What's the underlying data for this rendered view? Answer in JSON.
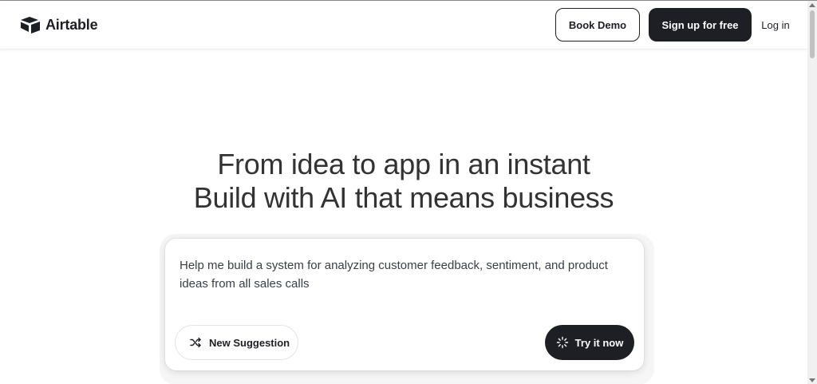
{
  "header": {
    "logo_text": "Airtable",
    "book_demo_label": "Book Demo",
    "signup_label": "Sign up for free",
    "login_label": "Log in"
  },
  "hero": {
    "line1": "From idea to app in an instant",
    "line2": "Build with AI that means business"
  },
  "prompt_card": {
    "prompt_text": "Help me build a system for analyzing customer feedback, sentiment, and product ideas from all sales calls",
    "new_suggestion_label": "New Suggestion",
    "try_label": "Try it now"
  },
  "icons": {
    "logo": "airtable-logo-icon",
    "shuffle": "shuffle-icon",
    "spinner": "sparkle-spinner-icon"
  },
  "colors": {
    "primary_dark": "#1d1f25",
    "headline": "#333333",
    "background": "#ffffff"
  }
}
